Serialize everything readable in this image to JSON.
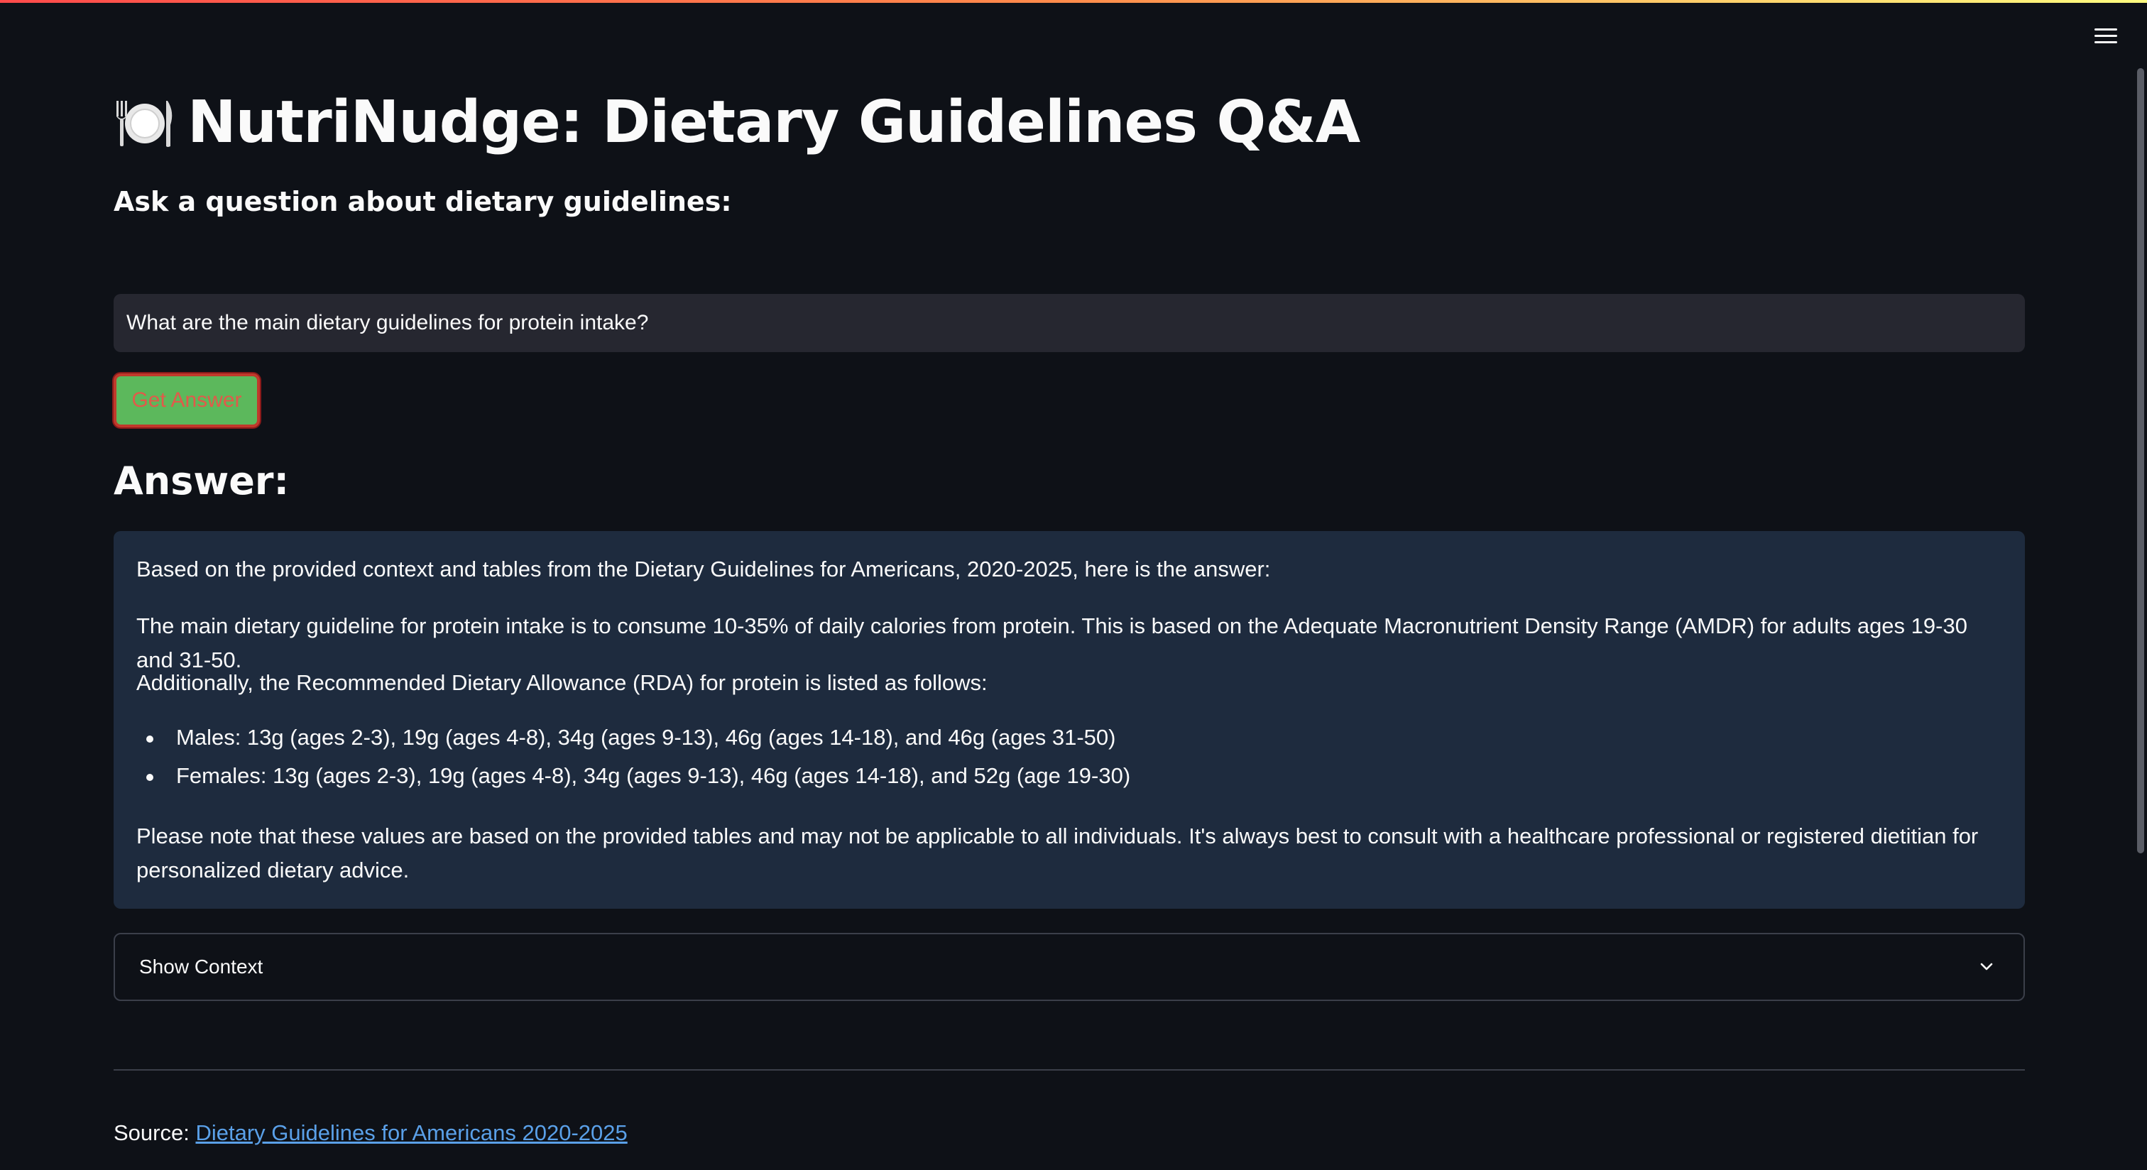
{
  "app": {
    "title": "NutriNudge: Dietary Guidelines Q&A",
    "title_icon": "plate-with-cutlery-icon",
    "subtitle": "Ask a question about dietary guidelines:"
  },
  "question": {
    "value": "What are the main dietary guidelines for protein intake?"
  },
  "button": {
    "label": "Get Answer"
  },
  "answer": {
    "heading": "Answer:",
    "intro": "Based on the provided context and tables from the Dietary Guidelines for Americans, 2020-2025, here is the answer:",
    "main": "The main dietary guideline for protein intake is to consume 10-35% of daily calories from protein. This is based on the Adequate Macronutrient Density Range (AMDR) for adults ages 19-30 and 31-50.",
    "rda_intro": "Additionally, the Recommended Dietary Allowance (RDA) for protein is listed as follows:",
    "bullets": [
      "Males: 13g (ages 2-3), 19g (ages 4-8), 34g (ages 9-13), 46g (ages 14-18), and 46g (ages 31-50)",
      "Females: 13g (ages 2-3), 19g (ages 4-8), 34g (ages 9-13), 46g (ages 14-18), and 52g (age 19-30)"
    ],
    "note": "Please note that these values are based on the provided tables and may not be applicable to all individuals. It's always best to consult with a healthcare professional or registered dietitian for personalized dietary advice."
  },
  "expander": {
    "label": "Show Context",
    "icon": "chevron-down-icon"
  },
  "footer": {
    "source_label": "Source:",
    "source_link_text": "Dietary Guidelines for Americans 2020-2025"
  },
  "colors": {
    "background": "#0e1117",
    "answer_box": "#1e2b3e",
    "input_bg": "#262730",
    "button_bg": "#5cb85c",
    "button_border": "#c0392b",
    "link": "#5aa0e8"
  }
}
